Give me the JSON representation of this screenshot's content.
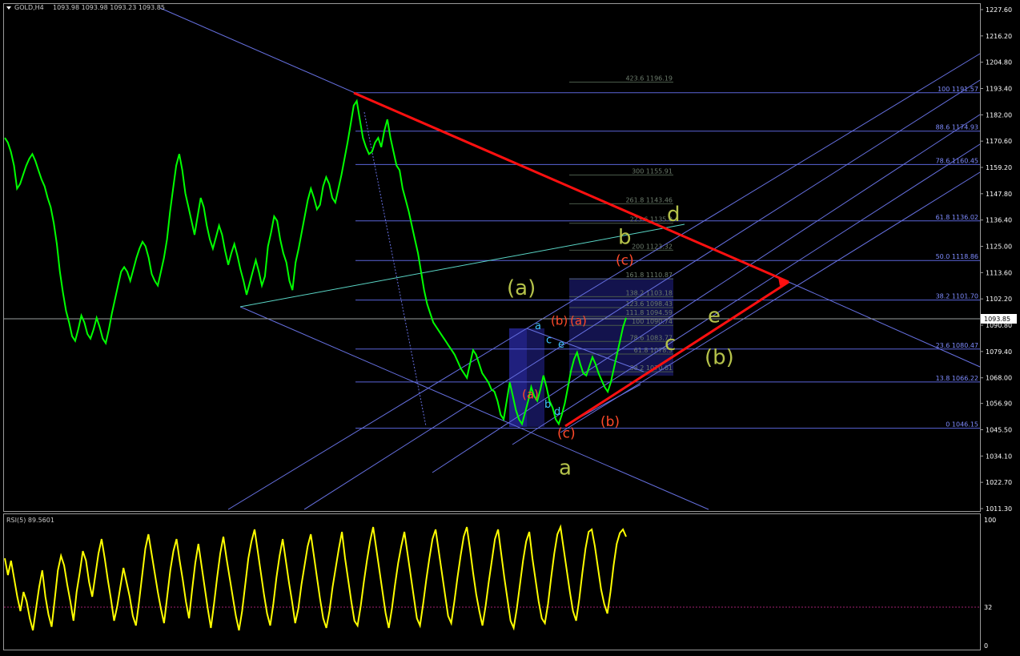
{
  "header": {
    "symbol": "GOLD,H4",
    "ohlc": "1093.98 1093.98 1093.23 1093.85"
  },
  "price_axis": {
    "ticks": [
      "1227.60",
      "1216.20",
      "1204.80",
      "1193.40",
      "1182.00",
      "1170.60",
      "1159.20",
      "1147.80",
      "1136.40",
      "1125.00",
      "1113.60",
      "1102.20",
      "1090.80",
      "1079.40",
      "1068.00",
      "1056.90",
      "1045.50",
      "1034.10",
      "1022.70",
      "1011.30"
    ],
    "current_price": "1093.85"
  },
  "rsi_panel": {
    "label": "RSI(5) 89.5601",
    "ticks": [
      "100",
      "32",
      "0"
    ],
    "level": 32
  },
  "fib_retracement": [
    {
      "label": "100 1191.57",
      "price": 1191.57
    },
    {
      "label": "88.6 1174.93",
      "price": 1174.93
    },
    {
      "label": "78.6 1160.45",
      "price": 1160.45
    },
    {
      "label": "61.8 1136.02",
      "price": 1136.02
    },
    {
      "label": "50.0 1118.86",
      "price": 1118.86
    },
    {
      "label": "38.2 1101.70",
      "price": 1101.7
    },
    {
      "label": "23.6 1080.47",
      "price": 1080.47
    },
    {
      "label": "13.8 1066.22",
      "price": 1066.22
    },
    {
      "label": "0 1046.15",
      "price": 1046.15
    }
  ],
  "fib_extension": [
    {
      "label": "423.6 1196.19",
      "price": 1196.19
    },
    {
      "label": "300 1155.91",
      "price": 1155.91
    },
    {
      "label": "261.8 1143.46",
      "price": 1143.46
    },
    {
      "label": "223.6 1135.0",
      "price": 1135.0
    },
    {
      "label": "200 1123.32",
      "price": 1123.32
    },
    {
      "label": "161.8 1110.87",
      "price": 1110.87
    },
    {
      "label": "138.2 1103.18",
      "price": 1103.18
    },
    {
      "label": "123.6 1098.43",
      "price": 1098.43
    },
    {
      "label": "111.8 1094.59",
      "price": 1094.59
    },
    {
      "label": "100 1090.74",
      "price": 1090.74
    },
    {
      "label": "78.6 1083.77",
      "price": 1083.77
    },
    {
      "label": "61.8 1078.3",
      "price": 1078.3
    },
    {
      "label": "38.2 1070.61",
      "price": 1070.61
    }
  ],
  "wave_labels": [
    {
      "text": "(a)",
      "price": 1104,
      "color": "#b5c24a",
      "size": 26
    },
    {
      "text": "a",
      "price": 1089,
      "color": "#3ec4ff",
      "size": 13
    },
    {
      "text": "c",
      "price": 1083,
      "color": "#3ec4ff",
      "size": 13
    },
    {
      "text": "e",
      "price": 1081,
      "color": "#3ec4ff",
      "size": 13
    },
    {
      "text": "b",
      "price": 1055,
      "color": "#3ec4ff",
      "size": 13
    },
    {
      "text": "d",
      "price": 1052,
      "color": "#3ec4ff",
      "size": 13
    },
    {
      "text": "(b)",
      "price": 1091,
      "color": "#ff4a2a",
      "size": 15
    },
    {
      "text": "(a)",
      "price": 1091,
      "color": "#ff4a2a",
      "size": 15
    },
    {
      "text": "(a)",
      "price": 1059,
      "color": "#ff4a2a",
      "size": 15
    },
    {
      "text": "(c)",
      "price": 1042,
      "color": "#ff4a2a",
      "size": 17
    },
    {
      "text": "(b)",
      "price": 1047,
      "color": "#ff4a2a",
      "size": 17
    },
    {
      "text": "(c)",
      "price": 1117,
      "color": "#ff4a2a",
      "size": 17
    },
    {
      "text": "a",
      "price": 1026,
      "color": "#b5c24a",
      "size": 26
    },
    {
      "text": "b",
      "price": 1126,
      "color": "#b5c24a",
      "size": 26
    },
    {
      "text": "d",
      "price": 1136,
      "color": "#b5c24a",
      "size": 26
    },
    {
      "text": "c",
      "price": 1080,
      "color": "#b5c24a",
      "size": 26
    },
    {
      "text": "e",
      "price": 1092,
      "color": "#b5c24a",
      "size": 26
    },
    {
      "text": "(b)",
      "price": 1074,
      "color": "#b5c24a",
      "size": 26
    }
  ],
  "colors": {
    "background": "#000000",
    "price_line": "#00ff00",
    "rsi_line": "#ffff00",
    "fib_level": "#5a64d8",
    "channel": "#6670e0",
    "triangle": "#ff1010",
    "wave_box": "#23238c"
  },
  "chart_data": [
    {
      "type": "line",
      "title": "GOLD,H4",
      "series": [
        {
          "values": [
            1172,
            1170,
            1166,
            1160,
            1150,
            1152,
            1156,
            1160,
            1163,
            1165,
            1162,
            1158,
            1154,
            1151,
            1146,
            1142,
            1135,
            1126,
            1114,
            1105,
            1097,
            1092,
            1086,
            1084,
            1089,
            1095,
            1092,
            1087,
            1085,
            1089,
            1094,
            1090,
            1085,
            1083,
            1089,
            1096,
            1102,
            1108,
            1114,
            1116,
            1114,
            1110,
            1115,
            1120,
            1124,
            1127,
            1125,
            1120,
            1113,
            1110,
            1108,
            1114,
            1120,
            1128,
            1140,
            1150,
            1160,
            1165,
            1158,
            1148,
            1142,
            1136,
            1130,
            1138,
            1146,
            1142,
            1134,
            1128,
            1124,
            1129,
            1134,
            1130,
            1123,
            1117,
            1122,
            1126,
            1121,
            1115,
            1110,
            1104,
            1109,
            1114,
            1119,
            1114,
            1108,
            1112,
            1125,
            1131,
            1138,
            1136,
            1128,
            1122,
            1118,
            1110,
            1106,
            1118,
            1124,
            1131,
            1138,
            1145,
            1150,
            1146,
            1141,
            1143,
            1151,
            1155,
            1152,
            1146,
            1144,
            1150,
            1156,
            1163,
            1170,
            1178,
            1186,
            1188,
            1180,
            1172,
            1168,
            1165,
            1166,
            1170,
            1172,
            1168,
            1175,
            1180,
            1172,
            1166,
            1160,
            1158,
            1150,
            1145,
            1140,
            1134,
            1128,
            1122,
            1114,
            1106,
            1100,
            1096,
            1092,
            1090,
            1088,
            1086,
            1084,
            1082,
            1080,
            1078,
            1075,
            1072,
            1070,
            1068,
            1074,
            1080,
            1078,
            1074,
            1070,
            1068,
            1066,
            1063,
            1062,
            1058,
            1052,
            1050,
            1058,
            1066,
            1060,
            1054,
            1050,
            1048,
            1053,
            1058,
            1064,
            1060,
            1058,
            1063,
            1069,
            1064,
            1058,
            1055,
            1050,
            1048,
            1052,
            1057,
            1064,
            1071,
            1076,
            1079,
            1074,
            1070,
            1069,
            1073,
            1077,
            1074,
            1070,
            1067,
            1064,
            1062,
            1066,
            1072,
            1078,
            1084,
            1090,
            1094
          ]
        }
      ],
      "x_range": [
        0,
        199
      ],
      "ylim": [
        1011.3,
        1227.6
      ],
      "grid": false
    },
    {
      "type": "line",
      "title": "RSI(5) 89.5601",
      "series": [
        {
          "values": [
            72,
            58,
            70,
            55,
            40,
            28,
            44,
            36,
            22,
            12,
            30,
            48,
            62,
            40,
            25,
            15,
            38,
            62,
            74,
            66,
            50,
            36,
            20,
            44,
            60,
            78,
            70,
            52,
            40,
            58,
            76,
            88,
            72,
            54,
            38,
            20,
            32,
            48,
            64,
            52,
            40,
            24,
            16,
            36,
            58,
            80,
            92,
            76,
            60,
            44,
            30,
            18,
            40,
            62,
            78,
            88,
            70,
            54,
            36,
            22,
            46,
            68,
            84,
            66,
            48,
            30,
            14,
            34,
            56,
            76,
            90,
            72,
            56,
            40,
            24,
            12,
            28,
            50,
            72,
            86,
            96,
            78,
            60,
            42,
            26,
            16,
            34,
            56,
            74,
            88,
            70,
            52,
            36,
            18,
            30,
            50,
            66,
            82,
            92,
            74,
            56,
            38,
            22,
            14,
            28,
            48,
            64,
            80,
            94,
            72,
            54,
            36,
            20,
            16,
            32,
            52,
            70,
            86,
            98,
            80,
            62,
            44,
            26,
            14,
            30,
            50,
            68,
            82,
            94,
            76,
            58,
            40,
            22,
            16,
            34,
            54,
            72,
            88,
            96,
            78,
            60,
            42,
            24,
            18,
            36,
            56,
            74,
            90,
            98,
            80,
            60,
            42,
            28,
            16,
            32,
            52,
            70,
            88,
            96,
            76,
            56,
            38,
            20,
            14,
            30,
            50,
            70,
            86,
            94,
            72,
            54,
            36,
            22,
            18,
            34,
            56,
            76,
            92,
            98,
            80,
            62,
            44,
            28,
            20,
            38,
            60,
            80,
            94,
            96,
            82,
            64,
            46,
            34,
            26,
            44,
            66,
            84,
            93,
            96,
            90
          ]
        }
      ],
      "ylim": [
        0,
        100
      ],
      "level": 32,
      "grid": false
    }
  ]
}
